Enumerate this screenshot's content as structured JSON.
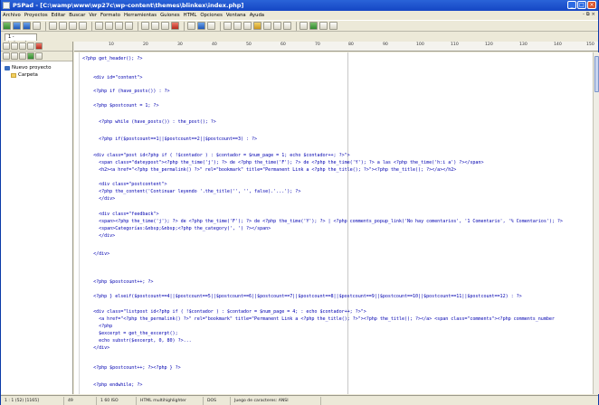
{
  "window": {
    "title": "PSPad - [C:\\wamp\\www\\wp27c\\wp-content\\themes\\blinkex\\index.php]"
  },
  "menu": {
    "items": [
      "Archivo",
      "Proyectos",
      "Editar",
      "Buscar",
      "Ver",
      "Formato",
      "Herramientas",
      "Guiones",
      "HTML",
      "Opciones",
      "Ventana",
      "Ayuda"
    ],
    "right_controls": "- ⧉ ×"
  },
  "tabs": {
    "file_tab": "1 - index.php"
  },
  "project_tree": {
    "root": "Nuevo proyecto",
    "child": "Carpeta"
  },
  "ruler": {
    "labels": [
      "10",
      "20",
      "30",
      "40",
      "50",
      "60",
      "70",
      "80",
      "90",
      "100",
      "110",
      "120",
      "130",
      "140",
      "150"
    ]
  },
  "code": {
    "lines": [
      "<?php get_header(); ?>",
      "",
      "    <div id=\"content\">",
      "",
      "    <?php if (have_posts()) : ?>",
      "",
      "    <?php $postcount = 1; ?>",
      "",
      "      <?php while (have_posts()) : the_post(); ?>",
      "",
      "      <?php if($postcount==1||$postcount==2||$postcount==3) : ?>",
      "",
      "    <div class=\"post id<?php if ( !$contador ) : $contador = $num_page = 1; echo $contador++; ?>\">",
      "      <span class=\"dateypost\"><?php the_time('j'); ?> de <?php the_time('F'); ?> de <?php the_time('Y'); ?> a las <?php the_time('h:i a') ?></span>",
      "      <h2><a href=\"<?php the_permalink() ?>\" rel=\"bookmark\" title=\"Permanent Link a <?php the_title(); ?>\"><?php the_title(); ?></a></h2>",
      "",
      "      <div class=\"postcontent\">",
      "      <?php the_content('Continuar leyendo '.the_title('', '', false).'...'); ?>",
      "      </div>",
      "",
      "      <div class=\"feedback\">",
      "      <span><?php the_time('j'); ?> de <?php the_time('F'); ?> de <?php the_time('Y'); ?> | <?php comments_popup_link('No hay comentarios', '1 Comentario', '% Comentarios'); ?>",
      "      <span>Categorías:&nbsp;&nbsp;<?php the_category(', ') ?></span>",
      "      </div>",
      "",
      "    </div>",
      "",
      "",
      "",
      "    <?php $postcount++; ?>",
      "",
      "    <?php } elseif($postcount==4||$postcount==5||$postcount==6||$postcount==7||$postcount==8||$postcount==9||$postcount==10||$postcount==11||$postcount==12) : ?>",
      "",
      "    <div class=\"listpost id<?php if ( !$contador ) : $contador = $num_page = 4; : echo $contador++; ?>\">",
      "      <a href=\"<?php the_permalink() ?>\" rel=\"bookmark\" title=\"Permanent Link a <?php the_title(); ?>\"><?php the_title(); ?></a> <span class=\"comments\"><?php comments_number",
      "      <?php",
      "      $excerpt = get_the_excerpt();",
      "      echo substr($excerpt, 0, 80) ?>...",
      "    </div>",
      "",
      "    <?php $postcount++; ?><?php } ?>",
      "",
      "    <?php endwhile; ?>"
    ]
  },
  "status": {
    "cells": [
      "1 : 1   (52)   [1165]",
      "49",
      "1   60  ISO",
      "HTML multihighlighter",
      "DOS",
      "Juego de caracteres: ANSI"
    ]
  }
}
